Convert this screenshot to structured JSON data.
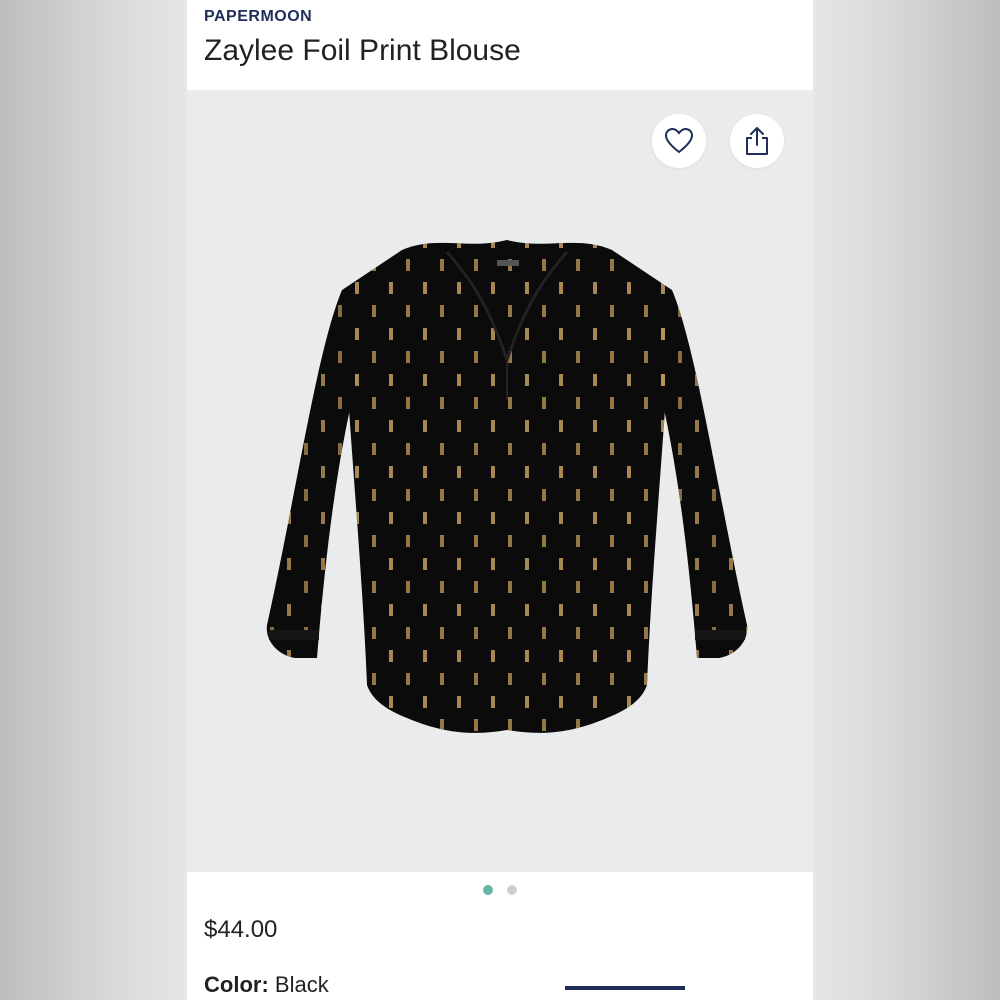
{
  "product": {
    "brand": "PAPERMOON",
    "title": "Zaylee Foil Print Blouse",
    "price": "$44.00",
    "color_label": "Color:",
    "color_value": "Black"
  },
  "gallery": {
    "image_count": 2,
    "active_index": 0,
    "colors": {
      "active_dot": "#69b4a8",
      "inactive_dot": "#cfcfcf"
    }
  },
  "actions": {
    "favorite_icon": "heart-icon",
    "share_icon": "share-icon"
  },
  "theme": {
    "brand_color": "#1f2d5a"
  }
}
